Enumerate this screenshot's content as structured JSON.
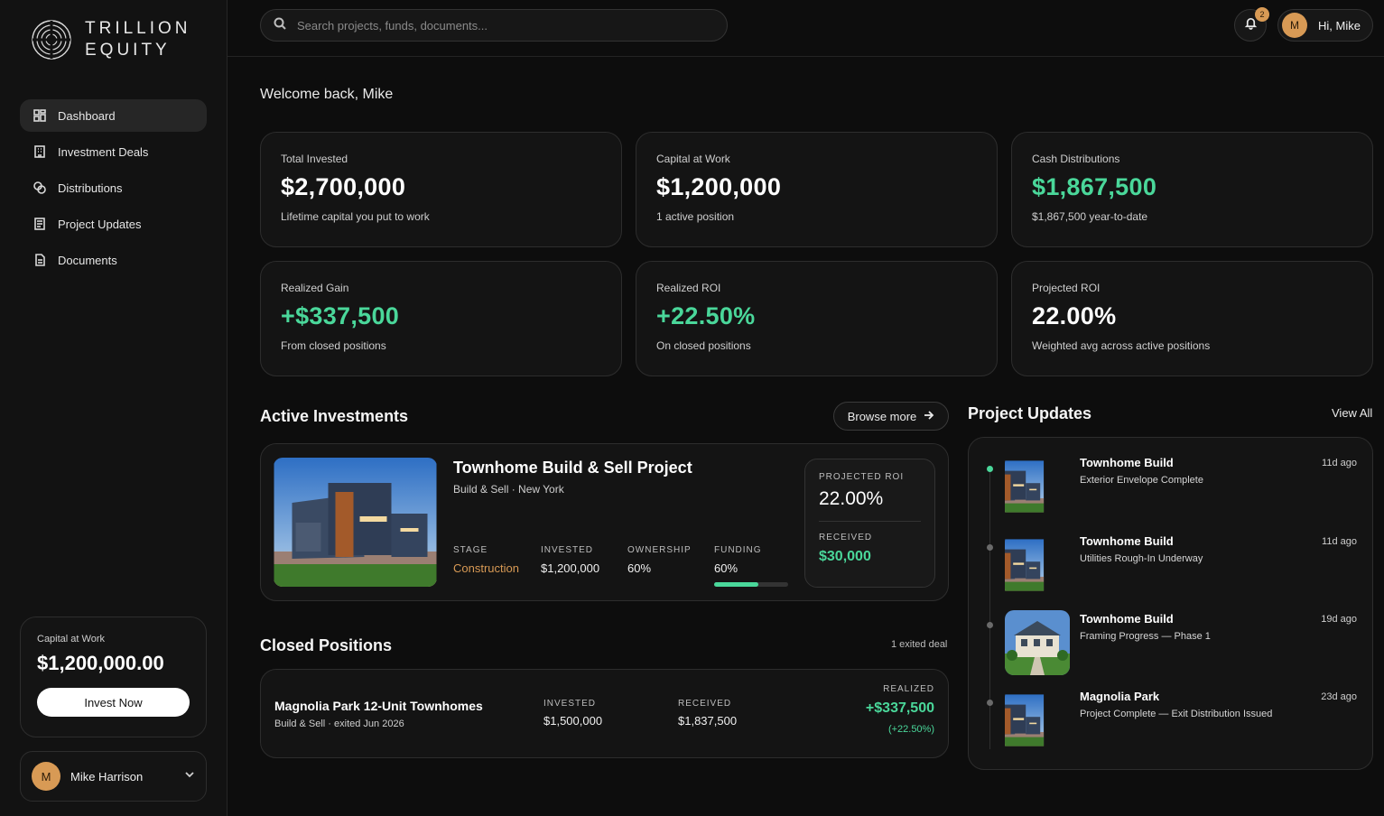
{
  "brand": {
    "line1": "TRILLION",
    "line2": "EQUITY"
  },
  "sidebar": {
    "items": [
      {
        "label": "Dashboard",
        "icon": "dashboard-icon",
        "active": true
      },
      {
        "label": "Investment Deals",
        "icon": "building-icon"
      },
      {
        "label": "Distributions",
        "icon": "coins-icon"
      },
      {
        "label": "Project Updates",
        "icon": "newspaper-icon"
      },
      {
        "label": "Documents",
        "icon": "document-icon"
      }
    ],
    "capital_card": {
      "label": "Capital at Work",
      "value": "$1,200,000.00",
      "button": "Invest Now"
    },
    "user": {
      "initial": "M",
      "name": "Mike Harrison"
    }
  },
  "topbar": {
    "search_placeholder": "Search projects, funds, documents...",
    "notifications": "2",
    "user_initial": "M",
    "greeting": "Hi, Mike"
  },
  "welcome": "Welcome back, Mike",
  "stats": [
    {
      "label": "Total Invested",
      "value": "$2,700,000",
      "sub": "Lifetime capital you put to work",
      "green": false
    },
    {
      "label": "Capital at Work",
      "value": "$1,200,000",
      "sub": "1 active position",
      "green": false
    },
    {
      "label": "Cash Distributions",
      "value": "$1,867,500",
      "sub": "$1,867,500 year-to-date",
      "green": true
    },
    {
      "label": "Realized Gain",
      "value": "+$337,500",
      "sub": "From closed positions",
      "green": true
    },
    {
      "label": "Realized ROI",
      "value": "+22.50%",
      "sub": "On closed positions",
      "green": true
    },
    {
      "label": "Projected ROI",
      "value": "22.00%",
      "sub": "Weighted avg across active positions",
      "green": false
    }
  ],
  "active": {
    "title": "Active Investments",
    "browse": "Browse more",
    "card": {
      "title": "Townhome Build & Sell Project",
      "subtitle": "Build & Sell · New York",
      "stage_k": "STAGE",
      "stage_v": "Construction",
      "invested_k": "INVESTED",
      "invested_v": "$1,200,000",
      "ownership_k": "OWNERSHIP",
      "ownership_v": "60%",
      "funding_k": "FUNDING",
      "funding_v": "60%",
      "funding_fraction": 0.6,
      "roi_k": "PROJECTED ROI",
      "roi_v": "22.00%",
      "received_k": "RECEIVED",
      "received_v": "$30,000"
    }
  },
  "closed": {
    "title": "Closed Positions",
    "count": "1 exited deal",
    "card": {
      "title": "Magnolia Park 12-Unit Townhomes",
      "subtitle": "Build & Sell · exited Jun 2026",
      "invested_k": "INVESTED",
      "invested_v": "$1,500,000",
      "received_k": "RECEIVED",
      "received_v": "$1,837,500",
      "realized_k": "REALIZED",
      "realized_v": "+$337,500",
      "realized_pct": "(+22.50%)"
    }
  },
  "updates": {
    "title": "Project Updates",
    "view_all": "View All",
    "items": [
      {
        "title": "Townhome Build",
        "sub": "Exterior Envelope Complete",
        "ago": "11d ago"
      },
      {
        "title": "Townhome Build",
        "sub": "Utilities Rough-In Underway",
        "ago": "11d ago"
      },
      {
        "title": "Townhome Build",
        "sub": "Framing Progress — Phase 1",
        "ago": "19d ago"
      },
      {
        "title": "Magnolia Park",
        "sub": "Project Complete — Exit Distribution Issued",
        "ago": "23d ago"
      }
    ]
  },
  "colors": {
    "accent_green": "#4ad79a",
    "accent_orange": "#d89a55"
  }
}
